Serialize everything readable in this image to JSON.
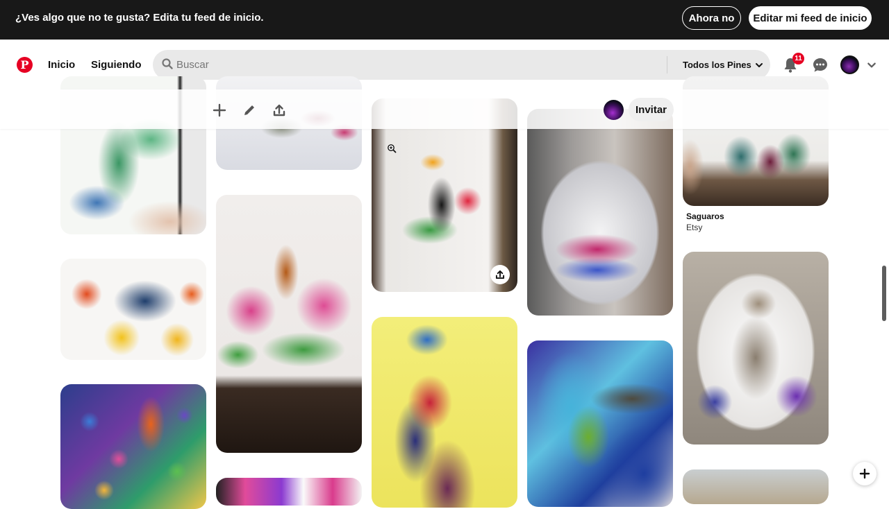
{
  "banner": {
    "text": "¿Ves algo que no te gusta? Edita tu feed de inicio.",
    "dismiss_label": "Ahora no",
    "edit_label": "Editar mi feed de inicio"
  },
  "header": {
    "nav_home": "Inicio",
    "nav_following": "Siguiendo",
    "search_placeholder": "Buscar",
    "filter_label": "Todos los Pines",
    "notifications_count": "11"
  },
  "board_toolbar": {
    "invite_label": "Invitar"
  },
  "pins": [
    {
      "caption_title": "Saguaros",
      "caption_source": "Etsy"
    }
  ],
  "colors": {
    "brand": "#e60023",
    "banner_bg": "#181818",
    "search_bg": "#e9e9e9"
  },
  "icons": [
    "pinterest-logo",
    "search-icon",
    "chevron-down-icon",
    "bell-icon",
    "chat-icon",
    "plus-icon",
    "pencil-icon",
    "share-icon",
    "zoom-icon"
  ]
}
